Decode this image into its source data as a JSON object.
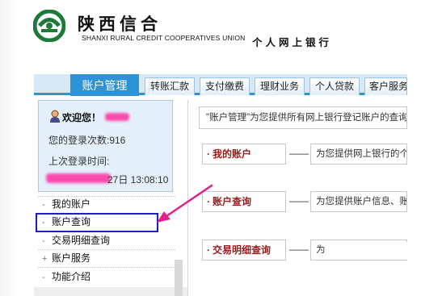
{
  "header": {
    "logo_cn": "陕西信合",
    "logo_en": "SHANXI RURAL CREDIT COOPERATIVES UNION",
    "bank_title": "个人网上银行"
  },
  "nav": {
    "tabs": [
      {
        "label": "账户管理",
        "active": true
      },
      {
        "label": "转账汇款",
        "active": false
      },
      {
        "label": "支付缴费",
        "active": false
      },
      {
        "label": "理财业务",
        "active": false
      },
      {
        "label": "个人贷款",
        "active": false
      },
      {
        "label": "客户服务",
        "active": false
      }
    ]
  },
  "user": {
    "welcome": "欢迎您！",
    "login_count": "您的登录次数:916",
    "last_login_label": "上次登录时间:",
    "last_login_time_visible": "27日 13:08:10"
  },
  "menu": {
    "items": [
      {
        "label": "我的账户",
        "marker": "-"
      },
      {
        "label": "账户查询",
        "marker": "-"
      },
      {
        "label": "交易明细查询",
        "marker": "-"
      },
      {
        "label": "账户服务",
        "marker": "+"
      },
      {
        "label": "功能介绍",
        "marker": "-"
      }
    ]
  },
  "content": {
    "intro": "\"账户管理\"为您提供所有网上银行登记账户的查询",
    "rows": [
      {
        "label": "我的账户",
        "dash": "——",
        "desc": "为您提供网上银行的个人"
      },
      {
        "label": "账户查询",
        "dash": "——",
        "desc": "为您提供账户信息、账户"
      },
      {
        "label": "交易明细查询",
        "dash": "——",
        "desc": "为"
      }
    ]
  },
  "colors": {
    "nav_active": "#2b93d6",
    "highlight_box": "#1b1ec9",
    "annotation_arrow": "#e0218a",
    "row_label": "#9b1b1b",
    "logo_green": "#1f7a3a"
  }
}
